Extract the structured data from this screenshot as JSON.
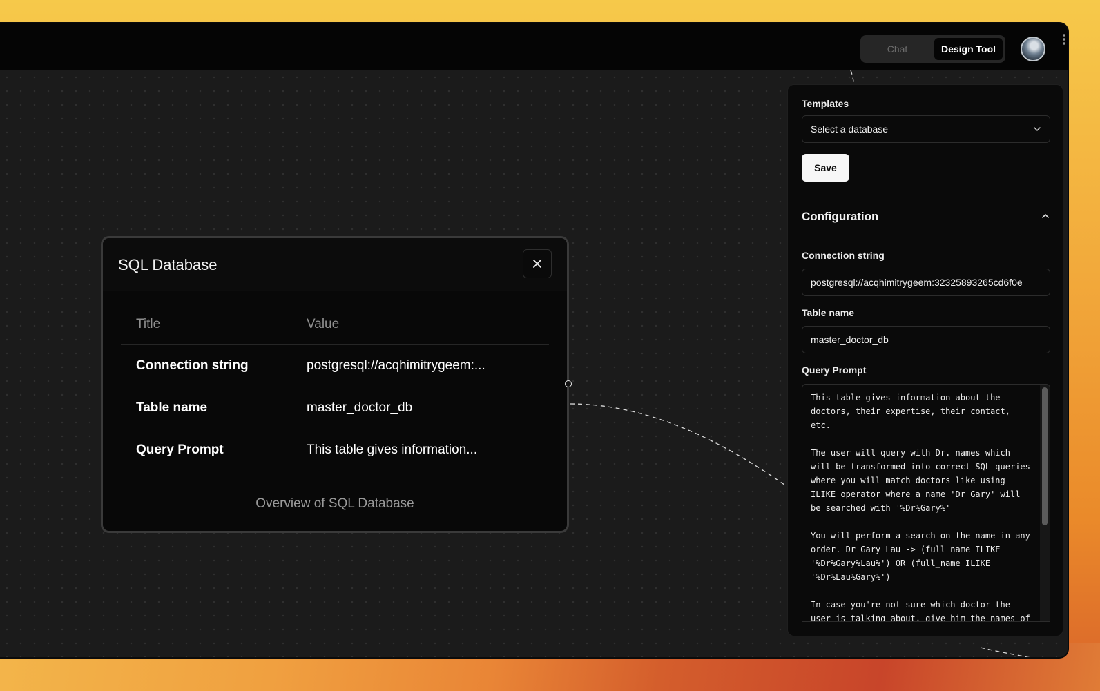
{
  "header": {
    "tabs": [
      {
        "label": "Chat",
        "active": false
      },
      {
        "label": "Design Tool",
        "active": true
      }
    ],
    "avatar_icon": "user-avatar"
  },
  "node": {
    "title": "SQL Database",
    "columns": {
      "title": "Title",
      "value": "Value"
    },
    "rows": [
      {
        "title": "Connection string",
        "value": "postgresql://acqhimitrygeem:..."
      },
      {
        "title": "Table name",
        "value": "master_doctor_db"
      },
      {
        "title": "Query Prompt",
        "value": "This table gives information..."
      }
    ],
    "caption": "Overview of SQL Database"
  },
  "panel": {
    "templates_label": "Templates",
    "select_value": "Select a database",
    "save_label": "Save",
    "configuration_title": "Configuration",
    "connection_label": "Connection string",
    "connection_value": "postgresql://acqhimitrygeem:32325893265cd6f0e",
    "table_label": "Table name",
    "table_value": "master_doctor_db",
    "query_label": "Query Prompt",
    "query_value": "This table gives information about the doctors, their expertise, their contact, etc.\n\nThe user will query with Dr. names which will be transformed into correct SQL queries where you will match doctors like using ILIKE operator where a name 'Dr Gary' will be searched with '%Dr%Gary%'\n\nYou will perform a search on the name in any order. Dr Gary Lau -> (full_name ILIKE '%Dr%Gary%Lau%') OR (full_name ILIKE '%Dr%Lau%Gary%')\n\nIn case you're not sure which doctor the user is talking about, give him the names of"
  },
  "colors": {
    "accent_active": "#050505",
    "panel_bg": "#0a0a0a",
    "canvas_bg": "#1b1b1b"
  }
}
